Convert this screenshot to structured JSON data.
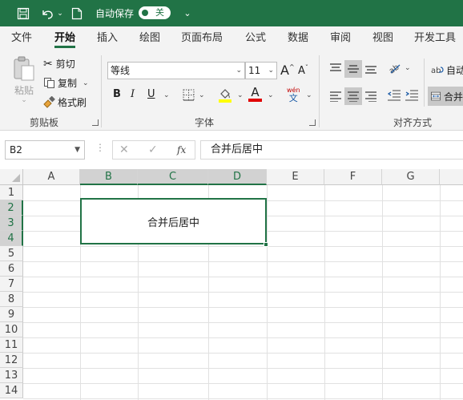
{
  "titlebar": {
    "autosave_label": "自动保存",
    "autosave_state": "关",
    "icons": [
      "save-icon",
      "undo-icon",
      "new-file-icon",
      "customize-toolbar-icon"
    ],
    "color": "#217346"
  },
  "tabs": [
    "文件",
    "开始",
    "插入",
    "绘图",
    "页面布局",
    "公式",
    "数据",
    "审阅",
    "视图",
    "开发工具"
  ],
  "active_tab": "开始",
  "ribbon": {
    "clipboard": {
      "paste_label": "粘贴",
      "cut_label": "剪切",
      "copy_label": "复制",
      "format_painter_label": "格式刷",
      "group_label": "剪贴板"
    },
    "font": {
      "font_name": "等线",
      "font_size": "11",
      "grow_label": "A",
      "shrink_label": "A",
      "bold": "B",
      "italic": "I",
      "underline": "U",
      "font_color_label": "A",
      "phonetic_top": "wén",
      "phonetic_bottom": "文",
      "group_label": "字体",
      "fill_color": "#ffff00",
      "font_color": "#e00000"
    },
    "alignment": {
      "wrap_label": "自动",
      "merge_label": "合并",
      "group_label": "对齐方式"
    }
  },
  "formula_bar": {
    "name_box": "B2",
    "fx": "fx",
    "formula": "合并后居中"
  },
  "grid": {
    "columns": [
      "A",
      "B",
      "C",
      "D",
      "E",
      "F",
      "G"
    ],
    "rows": [
      "1",
      "2",
      "3",
      "4",
      "5",
      "6",
      "7",
      "8",
      "9",
      "10",
      "11",
      "12",
      "13",
      "14"
    ],
    "selected_columns": [
      "B",
      "C",
      "D"
    ],
    "selected_rows": [
      "2",
      "3",
      "4"
    ],
    "merged_cell_text": "合并后居中",
    "accent": "#217346"
  }
}
